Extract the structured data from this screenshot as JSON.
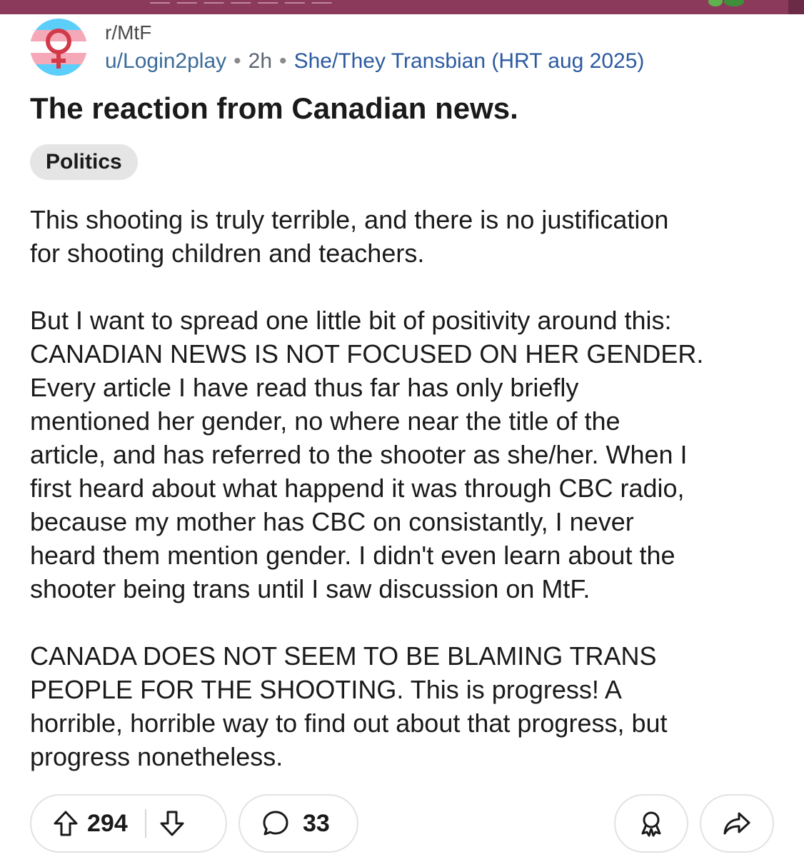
{
  "header": {
    "subreddit": "r/MtF",
    "username": "u/Login2play",
    "separator": "•",
    "age": "2h",
    "user_flair": "She/They Transbian (HRT aug 2025)"
  },
  "post": {
    "title": "The reaction from Canadian news.",
    "tag": "Politics",
    "paragraphs": [
      "This shooting is truly terrible, and there is no justification\nfor shooting children and teachers.",
      "But I want to spread one little bit of positivity around this:\nCANADIAN NEWS IS NOT FOCUSED ON HER GENDER.\nEvery article I have read thus far has only briefly\nmentioned her gender, no where near the title of the\narticle, and has referred to the shooter as she/her. When I\nfirst heard about what happend it was through CBC radio,\nbecause my mother has CBC on consistantly, I never\nheard them mention gender. I didn't even learn about the\nshooter being trans until I saw discussion on MtF.",
      "CANADA DOES NOT SEEM TO BE BLAMING TRANS\nPEOPLE FOR THE SHOOTING. This is progress! A\nhorrible, horrible way to find out about that progress, but\nprogress nonetheless."
    ]
  },
  "actions": {
    "upvotes": "294",
    "comments": "33",
    "icons": {
      "upvote": "arrow-up-icon",
      "downvote": "arrow-down-icon",
      "comment": "comment-bubble-icon",
      "award": "award-icon",
      "share": "share-arrow-icon"
    }
  },
  "colors": {
    "top_bar": "#8b3a5c",
    "username": "#3b6b9a",
    "flair": "#2c5aa0",
    "tag_bg": "#e5e5e5",
    "trans_blue": "#5bcefa",
    "trans_pink": "#f5a9b8",
    "symbol_red": "#d23a4a"
  }
}
